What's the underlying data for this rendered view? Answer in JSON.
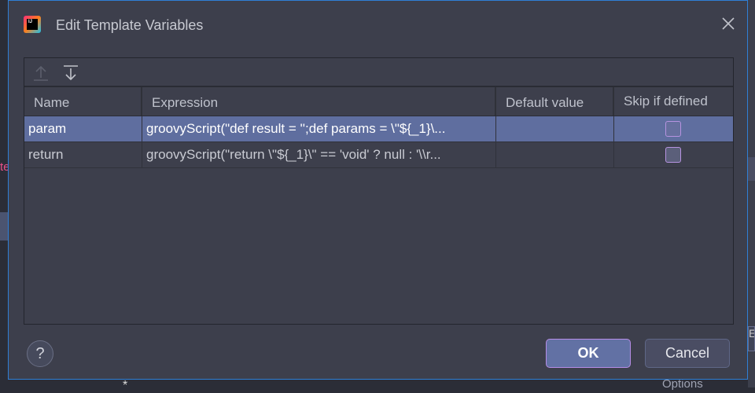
{
  "background": {
    "left_text": "te",
    "right_text": "Ec",
    "options_label": "Options",
    "star": "*"
  },
  "dialog": {
    "title": "Edit Template Variables",
    "logo_text": "IJ"
  },
  "table": {
    "columns": [
      "Name",
      "Expression",
      "Default value",
      "Skip if defined"
    ],
    "rows": [
      {
        "name": "param",
        "expression": "groovyScript(\"def result = '';def params = \\\"${_1}\\...",
        "default": "",
        "skip": false,
        "selected": true
      },
      {
        "name": "return",
        "expression": "groovyScript(\"return \\\"${_1}\\\" == 'void' ? null : '\\\\r...",
        "default": "",
        "skip": false,
        "selected": false
      }
    ]
  },
  "buttons": {
    "help": "?",
    "ok": "OK",
    "cancel": "Cancel"
  }
}
